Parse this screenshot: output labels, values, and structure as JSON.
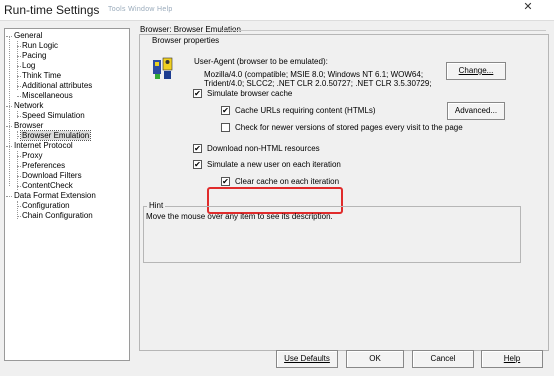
{
  "window": {
    "title": "Run-time Settings",
    "ghost_menu": "Tools   Window   Help",
    "close_glyph": "✕"
  },
  "tree": {
    "items": [
      {
        "label": "General",
        "level": 0,
        "selected": false
      },
      {
        "label": "Run Logic",
        "level": 1,
        "selected": false
      },
      {
        "label": "Pacing",
        "level": 1,
        "selected": false
      },
      {
        "label": "Log",
        "level": 1,
        "selected": false
      },
      {
        "label": "Think Time",
        "level": 1,
        "selected": false
      },
      {
        "label": "Additional attributes",
        "level": 1,
        "selected": false
      },
      {
        "label": "Miscellaneous",
        "level": 1,
        "selected": false
      },
      {
        "label": "Network",
        "level": 0,
        "selected": false
      },
      {
        "label": "Speed Simulation",
        "level": 1,
        "selected": false
      },
      {
        "label": "Browser",
        "level": 0,
        "selected": false
      },
      {
        "label": "Browser Emulation",
        "level": 1,
        "selected": true
      },
      {
        "label": "Internet Protocol",
        "level": 0,
        "selected": false
      },
      {
        "label": "Proxy",
        "level": 1,
        "selected": false
      },
      {
        "label": "Preferences",
        "level": 1,
        "selected": false
      },
      {
        "label": "Download Filters",
        "level": 1,
        "selected": false
      },
      {
        "label": "ContentCheck",
        "level": 1,
        "selected": false
      },
      {
        "label": "Data Format Extension",
        "level": 0,
        "selected": false
      },
      {
        "label": "Configuration",
        "level": 1,
        "selected": false
      },
      {
        "label": "Chain Configuration",
        "level": 1,
        "selected": false
      }
    ]
  },
  "panel": {
    "title": "Browser: Browser Emulation",
    "properties_group": "Browser properties",
    "user_agent": {
      "label": "User-Agent (browser to be emulated):",
      "line1": "Mozilla/4.0 (compatible; MSIE 8.0; Windows NT 6.1; WOW64;",
      "line2": "Trident/4.0; SLCC2; .NET CLR 2.0.50727; .NET CLR 3.5.30729;",
      "change_button": "Change..."
    },
    "options": {
      "simulate_cache": {
        "label": "Simulate browser cache",
        "checked": true
      },
      "cache_urls": {
        "label": "Cache URLs requiring content (HTMLs)",
        "checked": true
      },
      "advanced_button": "Advanced...",
      "check_newer": {
        "label": "Check for newer versions of stored pages every visit to the page",
        "checked": false
      },
      "download_non_html": {
        "label": "Download non-HTML resources",
        "checked": true
      },
      "simulate_new_user": {
        "label": "Simulate a new user on each iteration",
        "checked": true
      },
      "clear_cache": {
        "label": "Clear cache on each iteration",
        "checked": true
      }
    },
    "check_mark": "✔"
  },
  "hint": {
    "group_label": "Hint",
    "text": "Move the mouse over any item to see its description."
  },
  "buttons": {
    "use_defaults": "Use Defaults",
    "ok": "OK",
    "cancel": "Cancel",
    "help": "Help"
  },
  "colors": {
    "highlight": "#e02b2b",
    "dialog_bg": "#f0f0f0"
  }
}
